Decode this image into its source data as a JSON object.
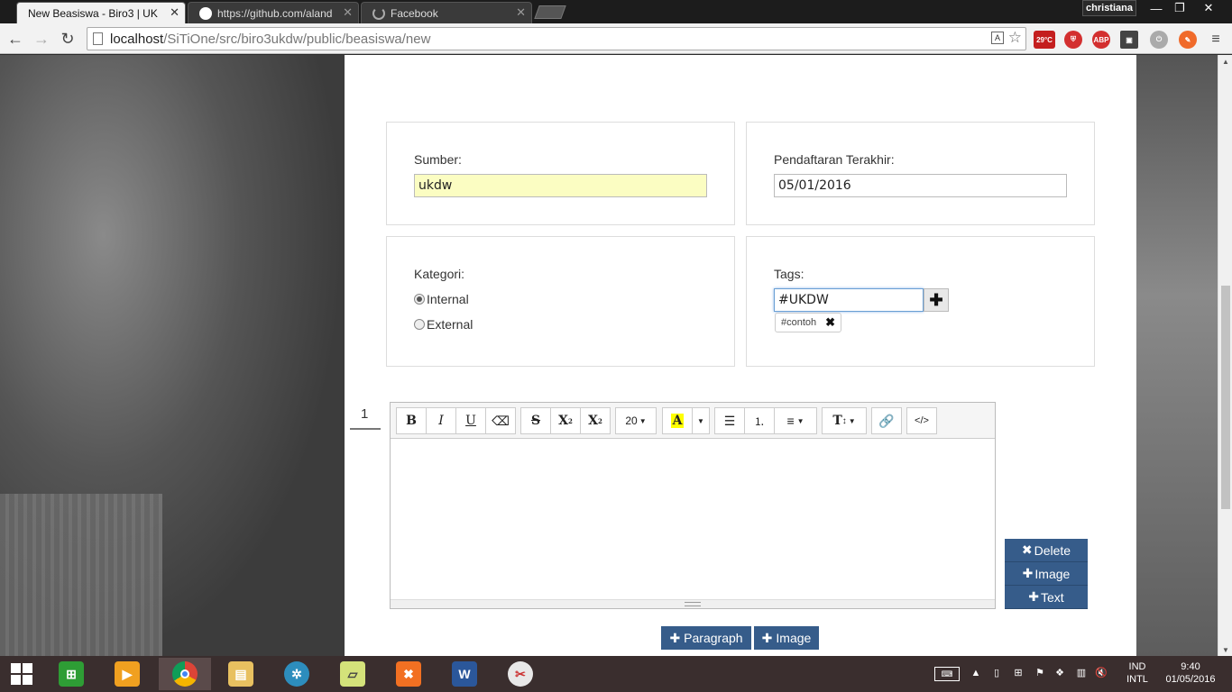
{
  "browser": {
    "tabs": [
      {
        "title": "New Beasiswa - Biro3 | UK",
        "active": true
      },
      {
        "title": "https://github.com/aland",
        "active": false
      },
      {
        "title": "Facebook",
        "active": false
      }
    ],
    "profile_name": "christiana",
    "url_host": "localhost",
    "url_path": "/SiTiOne/src/biro3ukdw/public/beasiswa/new",
    "weather": "29°C"
  },
  "form": {
    "sumber": {
      "label": "Sumber:",
      "value": "ukdw"
    },
    "pendaftaran": {
      "label": "Pendaftaran Terakhir:",
      "value": "05/01/2016"
    },
    "kategori": {
      "label": "Kategori:",
      "options": [
        {
          "label": "Internal",
          "checked": true
        },
        {
          "label": "External",
          "checked": false
        }
      ]
    },
    "tags": {
      "label": "Tags:",
      "input_value": "#UKDW",
      "add_glyph": "✚",
      "chips": [
        {
          "label": "#contoh"
        }
      ]
    }
  },
  "section": {
    "number": "1",
    "editor": {
      "toolbar": {
        "bold": "B",
        "italic": "I",
        "underline": "U",
        "eraser": "⌫",
        "strike": "S",
        "superscript": "X",
        "subscript": "X",
        "font_size": "20",
        "highlight": "A",
        "font_height": "T"
      }
    },
    "side_actions": {
      "delete": "Delete",
      "image": "Image",
      "text": "Text"
    }
  },
  "bottom_actions": {
    "paragraph": "Paragraph",
    "image": "Image"
  },
  "taskbar": {
    "lang_top": "IND",
    "lang_bottom": "INTL",
    "time": "9:40",
    "date": "01/05/2016"
  }
}
